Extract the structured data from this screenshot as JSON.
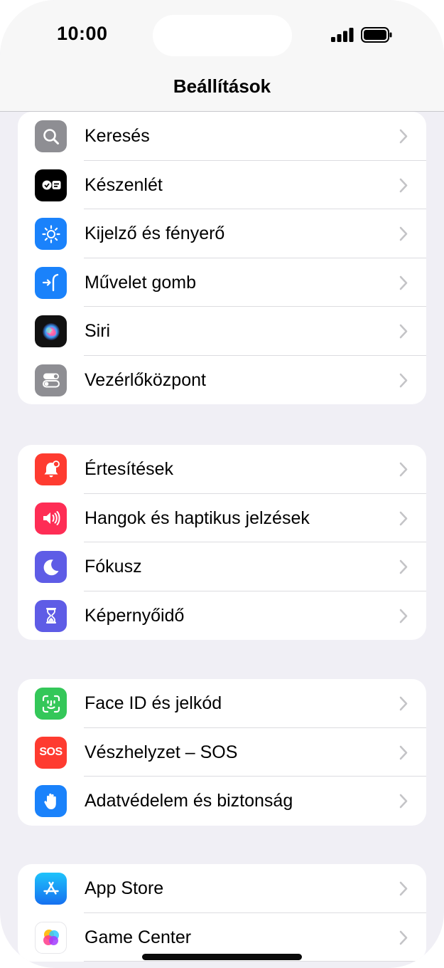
{
  "status_bar": {
    "time": "10:00"
  },
  "nav": {
    "title": "Beállítások"
  },
  "colors": {
    "background": "#f0eff5",
    "gray_icon": "#8e8e93",
    "blue_icon": "#1a82fb",
    "red_icon": "#fe3b30",
    "pink_icon": "#fe2d55",
    "indigo_icon": "#5e5ce6",
    "green_icon": "#34c759"
  },
  "groups": [
    {
      "items": [
        {
          "label": "Keresés",
          "icon": "search-icon"
        },
        {
          "label": "Készenlét",
          "icon": "standby-icon"
        },
        {
          "label": "Kijelző és fényerő",
          "icon": "brightness-icon"
        },
        {
          "label": "Művelet gomb",
          "icon": "action-button-icon"
        },
        {
          "label": "Siri",
          "icon": "siri-icon"
        },
        {
          "label": "Vezérlőközpont",
          "icon": "control-center-icon"
        }
      ]
    },
    {
      "items": [
        {
          "label": "Értesítések",
          "icon": "notifications-bell-icon"
        },
        {
          "label": "Hangok és haptikus jelzések",
          "icon": "sound-speaker-icon"
        },
        {
          "label": "Fókusz",
          "icon": "focus-moon-icon"
        },
        {
          "label": "Képernyőidő",
          "icon": "screen-time-hourglass-icon"
        }
      ]
    },
    {
      "items": [
        {
          "label": "Face ID és jelkód",
          "icon": "face-id-icon"
        },
        {
          "label": "Vészhelyzet – SOS",
          "icon": "sos-icon",
          "icon_text": "SOS"
        },
        {
          "label": "Adatvédelem és biztonság",
          "icon": "privacy-hand-icon"
        }
      ]
    },
    {
      "items": [
        {
          "label": "App Store",
          "icon": "app-store-icon"
        },
        {
          "label": "Game Center",
          "icon": "game-center-icon"
        }
      ]
    }
  ]
}
